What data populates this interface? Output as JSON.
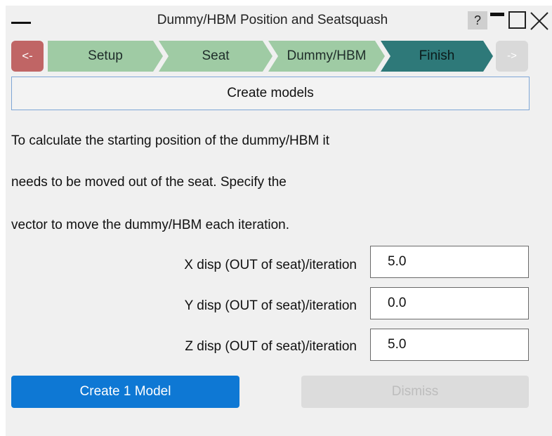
{
  "window": {
    "title": "Dummy/HBM Position and Seatsquash",
    "help_label": "?"
  },
  "stepbar": {
    "back_label": "<-",
    "steps": [
      {
        "label": "Setup",
        "state": "done"
      },
      {
        "label": "Seat",
        "state": "done"
      },
      {
        "label": "Dummy/HBM",
        "state": "done"
      },
      {
        "label": "Finish",
        "state": "current"
      }
    ],
    "next_label": "->"
  },
  "section": {
    "title": "Create models"
  },
  "description": [
    "To calculate the starting position of the dummy/HBM it",
    "needs to be moved out of the seat. Specify the",
    "vector to move the dummy/HBM each iteration."
  ],
  "fields": [
    {
      "label": "X disp (OUT of seat)/iteration",
      "value": "5.0"
    },
    {
      "label": "Y disp (OUT of seat)/iteration",
      "value": "0.0"
    },
    {
      "label": "Z disp (OUT of seat)/iteration",
      "value": "5.0"
    }
  ],
  "actions": {
    "create_label": "Create 1 Model",
    "dismiss_label": "Dismiss"
  },
  "colors": {
    "back_button": "#c06565",
    "step_done": "#9fcba4",
    "step_current": "#2e7979",
    "primary_button": "#0e78d4",
    "disabled_button": "#dcdcdc"
  }
}
